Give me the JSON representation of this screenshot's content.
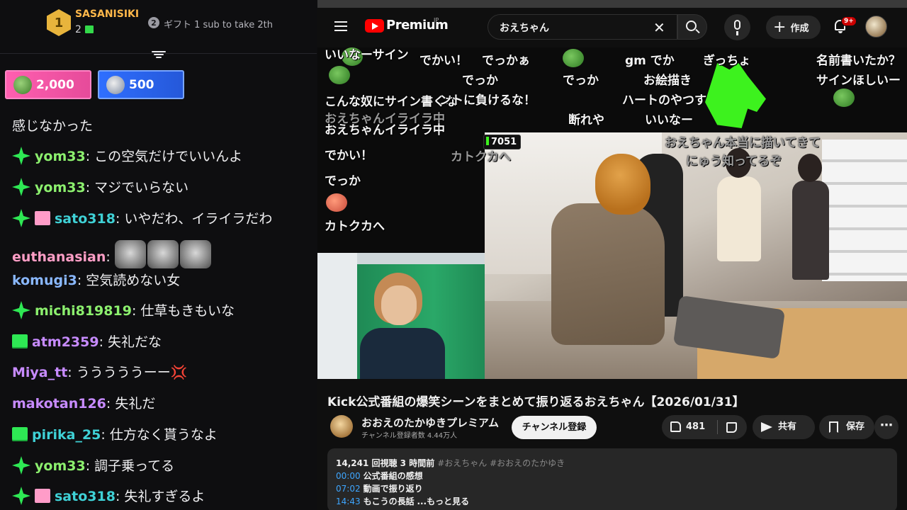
{
  "leaderboard": {
    "rank1": "1",
    "top_user": "SASANISIKI",
    "top_count": "2",
    "rank2": "2",
    "rank2_text": "ギフト 1 sub to take 2th"
  },
  "pills": [
    {
      "amount": "2,000"
    },
    {
      "amount": "500"
    }
  ],
  "chat": [
    {
      "user": "",
      "text": "感じなかった"
    },
    {
      "user": "yom33",
      "text": ": この空気だけでいいんよ"
    },
    {
      "user": "yom33",
      "text": ": マジでいらない"
    },
    {
      "user": "sato318",
      "text": ": いやだわ、イライラだわ"
    },
    {
      "user": "euthanasian",
      "text": ":"
    },
    {
      "user": "komugi3",
      "text": ": 空気読めない女"
    },
    {
      "user": "michi819819",
      "text": ": 仕草もきもいな"
    },
    {
      "user": "atm2359",
      "text": ": 失礼だな"
    },
    {
      "user": "Miya_tt",
      "text": ": うううううーー"
    },
    {
      "user": "makotan126",
      "text": ": 失礼だ"
    },
    {
      "user": "pirika_25",
      "text": ": 仕方なく貰うなよ"
    },
    {
      "user": "yom33",
      "text": ": 調子乗ってる"
    },
    {
      "user": "sato318",
      "text": ": 失礼すぎるよ"
    }
  ],
  "youtube": {
    "brand": "Premium",
    "region": "JP",
    "search_value": "おえちゃん",
    "create_label": "作成",
    "notif_count": "9+",
    "counter": "7051",
    "title": "Kick公式番組の爆笑シーンをまとめて振り返るおえちゃん【2026/01/31】",
    "channel": "おおえのたかゆきプレミアム",
    "subscribers": "チャンネル登録者数 4.44万人",
    "subscribe_label": "チャンネル登録",
    "likes": "481",
    "share_label": "共有",
    "save_label": "保存",
    "description": {
      "stats": "14,241 回視聴  3 時間前",
      "tags": "#おえちゃん #おおえのたかゆき",
      "chapters": [
        {
          "time": "00:00",
          "label": "公式番組の感想"
        },
        {
          "time": "07:02",
          "label": "動画で振り返り"
        },
        {
          "time": "14:43",
          "label": "もこうの長話"
        }
      ],
      "more": "...もっと見る"
    }
  },
  "danmaku": [
    "いいなーサイン",
    "でかい！",
    "でっかぁ",
    "gm でか",
    "ぎっちょ",
    "名前書いたか？",
    "でっか",
    "でっか",
    "お絵描き",
    "サインほしいー",
    "ハートのやつす",
    "こんな奴にサイン書くな",
    "ントに負けるな！",
    "断れや",
    "いいなー",
    "おえちゃんイライラ中",
    "おえちゃんイライラ中",
    "でかい！",
    "でっか",
    "カトクカへ",
    "カトクカへ",
    "おえちゃん本当に描いてきて",
    "にゅう知ってるぞ"
  ]
}
